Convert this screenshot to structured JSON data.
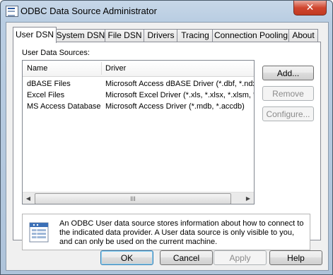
{
  "window": {
    "title": "ODBC Data Source Administrator",
    "close_glyph": "✕"
  },
  "tabs": [
    {
      "label": "User DSN",
      "active": true
    },
    {
      "label": "System DSN",
      "active": false
    },
    {
      "label": "File DSN",
      "active": false
    },
    {
      "label": "Drivers",
      "active": false
    },
    {
      "label": "Tracing",
      "active": false
    },
    {
      "label": "Connection Pooling",
      "active": false
    },
    {
      "label": "About",
      "active": false
    }
  ],
  "panel": {
    "sources_label": "User Data Sources:",
    "columns": {
      "name": "Name",
      "driver": "Driver"
    },
    "rows": [
      {
        "name": "dBASE Files",
        "driver": "Microsoft Access dBASE Driver (*.dbf, *.ndx"
      },
      {
        "name": "Excel Files",
        "driver": "Microsoft Excel Driver (*.xls, *.xlsx, *.xlsm, *.x"
      },
      {
        "name": "MS Access Database",
        "driver": "Microsoft Access Driver (*.mdb, *.accdb)"
      }
    ],
    "scroll_left": "◀",
    "scroll_right": "▶",
    "scroll_grip": "III",
    "buttons": {
      "add": "Add...",
      "remove": "Remove",
      "configure": "Configure..."
    },
    "info_text": "An ODBC User data source stores information about how to connect to the indicated data provider.   A User data source is only visible to you, and can only be used on the current machine."
  },
  "dialog_buttons": {
    "ok": "OK",
    "cancel": "Cancel",
    "apply": "Apply",
    "help": "Help"
  }
}
